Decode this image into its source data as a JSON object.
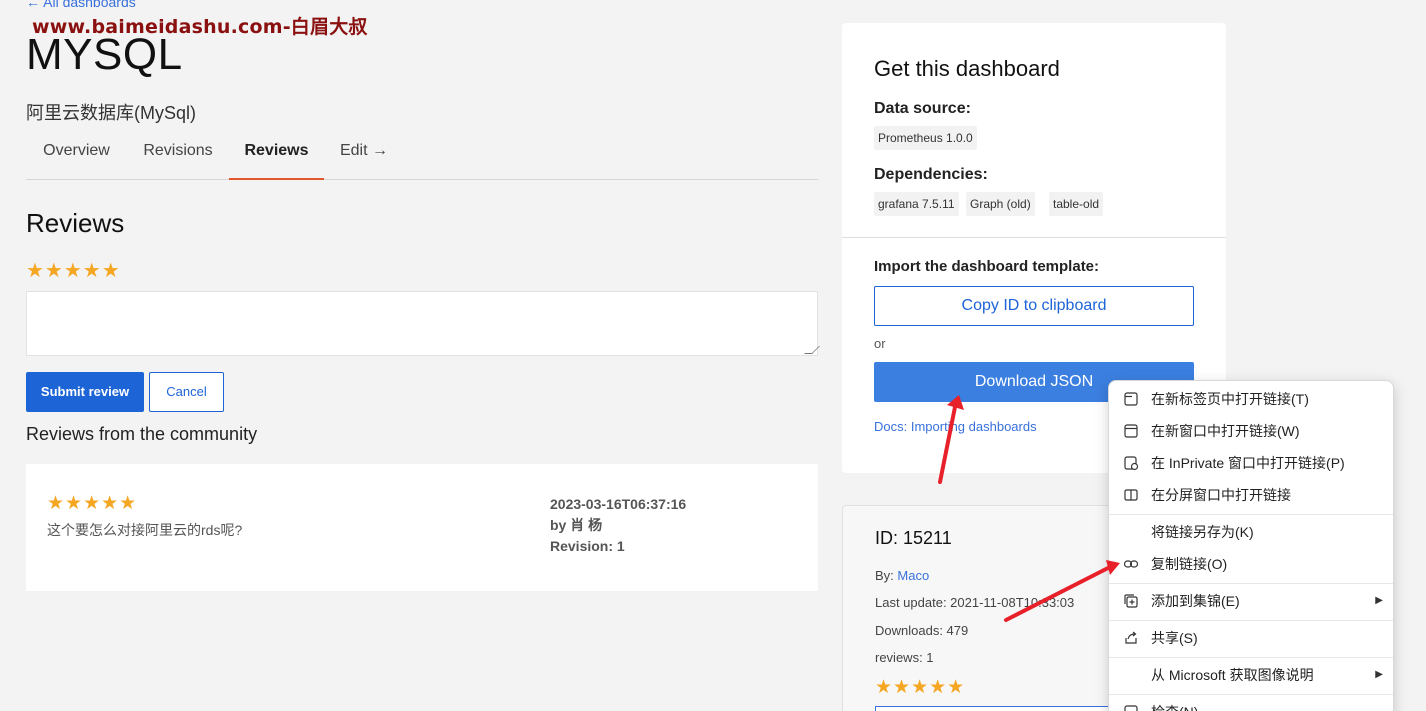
{
  "header": {
    "back_link": "← All dashboards",
    "watermark": "www.baimeidashu.com-白眉大叔",
    "title": "MYSQL",
    "subtitle": "阿里云数据库(MySql)"
  },
  "tabs": [
    {
      "label": "Overview"
    },
    {
      "label": "Revisions"
    },
    {
      "label": "Reviews"
    },
    {
      "label": "Edit →"
    }
  ],
  "reviews": {
    "heading": "Reviews",
    "rating_stars": "★★★★★",
    "submit_label": "Submit review",
    "cancel_label": "Cancel",
    "community_heading": "Reviews from the community",
    "items": [
      {
        "stars": "★★★★★",
        "text": "这个要怎么对接阿里云的rds呢?",
        "date": "2023-03-16T06:37:16",
        "author": "by 肖 杨",
        "revision": "Revision: 1"
      }
    ]
  },
  "panel": {
    "title": "Get this dashboard",
    "data_source_label": "Data source:",
    "data_source": "Prometheus 1.0.0",
    "dependencies_label": "Dependencies:",
    "dependencies": [
      "grafana 7.5.11",
      "Graph (old)",
      "table-old"
    ],
    "import_label": "Import the dashboard template:",
    "copy_label": "Copy ID to clipboard",
    "or_text": "or",
    "download_label": "Download JSON",
    "docs_link": "Docs: Importing dashboards"
  },
  "info": {
    "id": "ID: 15211",
    "by_prefix": "By: ",
    "by_name": "Maco",
    "last_update": "Last update: 2021-11-08T10:33:03",
    "downloads": "Downloads: 479",
    "reviews": "reviews: 1",
    "stars": "★★★★★"
  },
  "context_menu": {
    "items": [
      {
        "label": "在新标签页中打开链接(T)",
        "icon": "new-tab-icon"
      },
      {
        "label": "在新窗口中打开链接(W)",
        "icon": "new-window-icon"
      },
      {
        "label": "在 InPrivate 窗口中打开链接(P)",
        "icon": "inprivate-icon"
      },
      {
        "label": "在分屏窗口中打开链接",
        "icon": "split-screen-icon"
      },
      {
        "label": "将链接另存为(K)",
        "icon": ""
      },
      {
        "label": "复制链接(O)",
        "icon": "link-icon"
      },
      {
        "label": "添加到集锦(E)",
        "icon": "collections-icon"
      },
      {
        "label": "共享(S)",
        "icon": "share-icon"
      },
      {
        "label": "从 Microsoft 获取图像说明",
        "icon": ""
      },
      {
        "label": "检查(N)",
        "icon": "inspect-icon"
      }
    ]
  },
  "colors": {
    "accent": "#1d64d7",
    "tab_underline": "#e0572c",
    "star": "#f5a623",
    "annotation_arrow": "#e8202a"
  }
}
